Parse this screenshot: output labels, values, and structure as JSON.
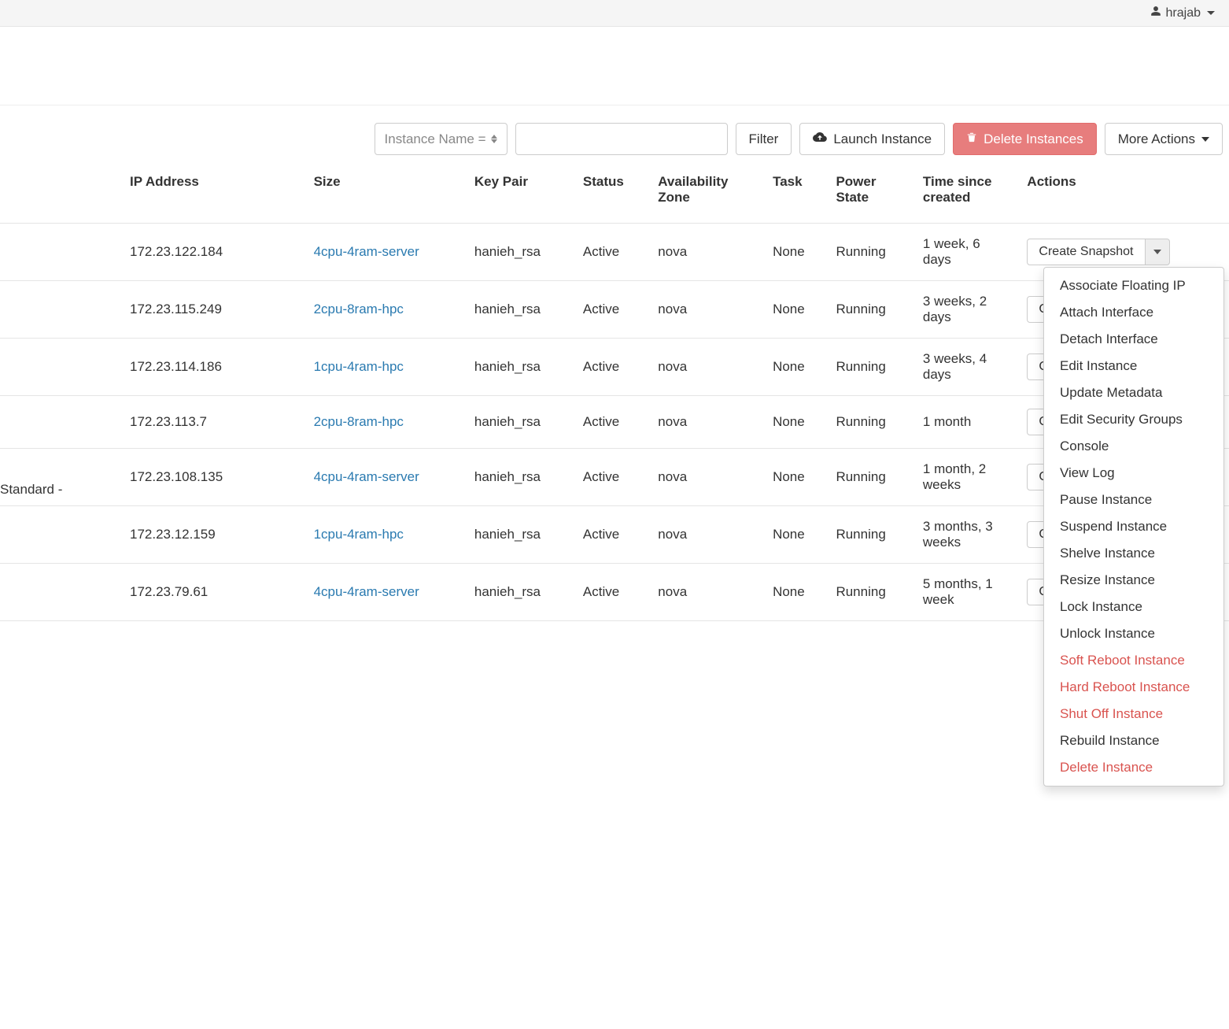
{
  "user": {
    "name": "hrajab"
  },
  "filter": {
    "selector_label": "Instance Name =",
    "input_value": ""
  },
  "toolbar": {
    "filter_btn": "Filter",
    "launch_btn": "Launch Instance",
    "delete_btn": "Delete Instances",
    "more_btn": "More Actions"
  },
  "columns": {
    "ip": "IP Address",
    "size": "Size",
    "keypair": "Key Pair",
    "status": "Status",
    "az": "Availability Zone",
    "task": "Task",
    "power": "Power State",
    "age": "Time since created",
    "actions": "Actions"
  },
  "rows": [
    {
      "ip": "172.23.122.184",
      "size": "4cpu-4ram-server",
      "keypair": "hanieh_rsa",
      "status": "Active",
      "az": "nova",
      "task": "None",
      "power": "Running",
      "age": "1 week, 6 days",
      "action": "Create Snapshot"
    },
    {
      "ip": "172.23.115.249",
      "size": "2cpu-8ram-hpc",
      "keypair": "hanieh_rsa",
      "status": "Active",
      "az": "nova",
      "task": "None",
      "power": "Running",
      "age": "3 weeks, 2 days",
      "action": "Create Snapshot"
    },
    {
      "ip": "172.23.114.186",
      "size": "1cpu-4ram-hpc",
      "keypair": "hanieh_rsa",
      "status": "Active",
      "az": "nova",
      "task": "None",
      "power": "Running",
      "age": "3 weeks, 4 days",
      "action": "Create Snapshot"
    },
    {
      "ip": "172.23.113.7",
      "size": "2cpu-8ram-hpc",
      "keypair": "hanieh_rsa",
      "status": "Active",
      "az": "nova",
      "task": "None",
      "power": "Running",
      "age": "1 month",
      "action": "Create Snapshot"
    },
    {
      "ip": "172.23.108.135",
      "size": "4cpu-4ram-server",
      "keypair": "hanieh_rsa",
      "status": "Active",
      "az": "nova",
      "task": "None",
      "power": "Running",
      "age": "1 month, 2 weeks",
      "action": "Create Snapshot"
    },
    {
      "ip": "172.23.12.159",
      "size": "1cpu-4ram-hpc",
      "keypair": "hanieh_rsa",
      "status": "Active",
      "az": "nova",
      "task": "None",
      "power": "Running",
      "age": "3 months, 3 weeks",
      "action": "Create Snapshot"
    },
    {
      "ip": "172.23.79.61",
      "size": "4cpu-4ram-server",
      "keypair": "hanieh_rsa",
      "status": "Active",
      "az": "nova",
      "task": "None",
      "power": "Running",
      "age": "5 months, 1 week",
      "action": "Create Snapshot"
    }
  ],
  "extra_label": "Standard -",
  "action_menu": [
    {
      "label": "Associate Floating IP",
      "danger": false
    },
    {
      "label": "Attach Interface",
      "danger": false
    },
    {
      "label": "Detach Interface",
      "danger": false
    },
    {
      "label": "Edit Instance",
      "danger": false
    },
    {
      "label": "Update Metadata",
      "danger": false
    },
    {
      "label": "Edit Security Groups",
      "danger": false
    },
    {
      "label": "Console",
      "danger": false
    },
    {
      "label": "View Log",
      "danger": false
    },
    {
      "label": "Pause Instance",
      "danger": false
    },
    {
      "label": "Suspend Instance",
      "danger": false
    },
    {
      "label": "Shelve Instance",
      "danger": false
    },
    {
      "label": "Resize Instance",
      "danger": false
    },
    {
      "label": "Lock Instance",
      "danger": false
    },
    {
      "label": "Unlock Instance",
      "danger": false
    },
    {
      "label": "Soft Reboot Instance",
      "danger": true
    },
    {
      "label": "Hard Reboot Instance",
      "danger": true
    },
    {
      "label": "Shut Off Instance",
      "danger": true
    },
    {
      "label": "Rebuild Instance",
      "danger": false
    },
    {
      "label": "Delete Instance",
      "danger": true
    }
  ]
}
